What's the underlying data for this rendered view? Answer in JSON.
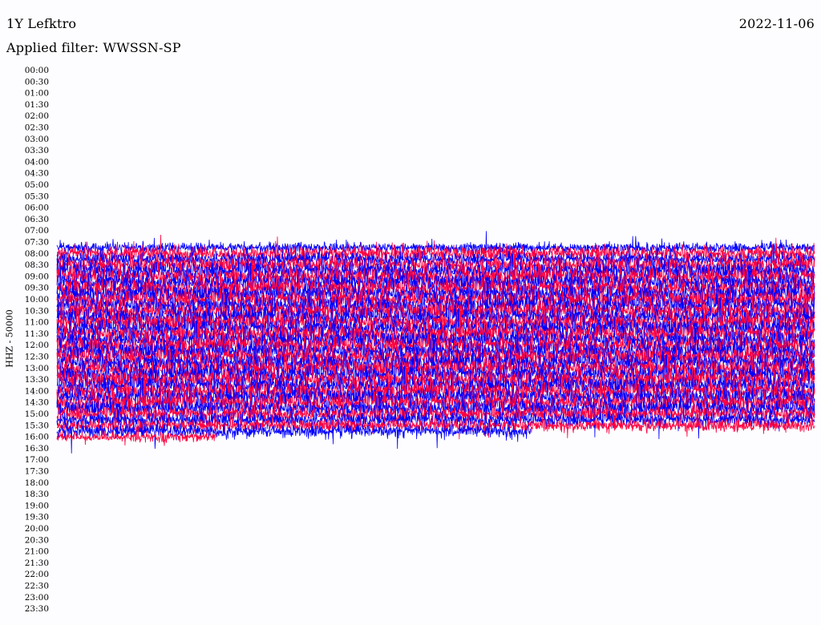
{
  "header": {
    "station": "1Y Lefktro",
    "date": "2022-11-06",
    "filter_text": "Applied filter: WWSSN-SP"
  },
  "chart_data": {
    "type": "line",
    "subtype": "helicorder",
    "ylabel": "HHZ - 50000",
    "row_interval_minutes": 15,
    "row_labels": [
      "00:00",
      "00:30",
      "01:00",
      "01:30",
      "02:00",
      "02:30",
      "03:00",
      "03:30",
      "04:00",
      "04:30",
      "05:00",
      "05:30",
      "06:00",
      "06:30",
      "07:00",
      "07:30",
      "08:00",
      "08:30",
      "09:00",
      "09:30",
      "10:00",
      "10:30",
      "11:00",
      "11:30",
      "12:00",
      "12:30",
      "13:00",
      "13:30",
      "14:00",
      "14:30",
      "15:00",
      "15:30",
      "16:00",
      "16:30",
      "17:00",
      "17:30",
      "18:00",
      "18:30",
      "19:00",
      "19:30",
      "20:00",
      "20:30",
      "21:00",
      "21:30",
      "22:00",
      "22:30",
      "23:00",
      "23:30"
    ],
    "series_colors": [
      "#0000ff",
      "#ff0040"
    ],
    "data_start": "07:45",
    "data_end": "16:30",
    "traces": [
      {
        "start": "07:45",
        "color": "#0000ff",
        "duration_fraction": 1.0,
        "amplitude": 8
      },
      {
        "start": "08:00",
        "color": "#ff0040",
        "duration_fraction": 1.0,
        "amplitude": 12
      },
      {
        "start": "08:15",
        "color": "#0000ff",
        "duration_fraction": 1.0,
        "amplitude": 10
      },
      {
        "start": "08:30",
        "color": "#ff0040",
        "duration_fraction": 1.0,
        "amplitude": 13
      },
      {
        "start": "08:45",
        "color": "#0000ff",
        "duration_fraction": 1.0,
        "amplitude": 14
      },
      {
        "start": "09:00",
        "color": "#ff0040",
        "duration_fraction": 1.0,
        "amplitude": 14
      },
      {
        "start": "09:15",
        "color": "#0000ff",
        "duration_fraction": 1.0,
        "amplitude": 14
      },
      {
        "start": "09:30",
        "color": "#ff0040",
        "duration_fraction": 1.0,
        "amplitude": 14
      },
      {
        "start": "09:45",
        "color": "#0000ff",
        "duration_fraction": 1.0,
        "amplitude": 14
      },
      {
        "start": "10:00",
        "color": "#ff0040",
        "duration_fraction": 1.0,
        "amplitude": 14
      },
      {
        "start": "10:15",
        "color": "#0000ff",
        "duration_fraction": 1.0,
        "amplitude": 14
      },
      {
        "start": "10:30",
        "color": "#ff0040",
        "duration_fraction": 1.0,
        "amplitude": 14
      },
      {
        "start": "10:45",
        "color": "#0000ff",
        "duration_fraction": 1.0,
        "amplitude": 14
      },
      {
        "start": "11:00",
        "color": "#ff0040",
        "duration_fraction": 1.0,
        "amplitude": 14
      },
      {
        "start": "11:15",
        "color": "#0000ff",
        "duration_fraction": 1.0,
        "amplitude": 14
      },
      {
        "start": "11:30",
        "color": "#ff0040",
        "duration_fraction": 1.0,
        "amplitude": 14
      },
      {
        "start": "11:45",
        "color": "#0000ff",
        "duration_fraction": 1.0,
        "amplitude": 14
      },
      {
        "start": "12:00",
        "color": "#ff0040",
        "duration_fraction": 1.0,
        "amplitude": 14
      },
      {
        "start": "12:15",
        "color": "#0000ff",
        "duration_fraction": 1.0,
        "amplitude": 14
      },
      {
        "start": "12:30",
        "color": "#ff0040",
        "duration_fraction": 1.0,
        "amplitude": 14
      },
      {
        "start": "12:45",
        "color": "#0000ff",
        "duration_fraction": 1.0,
        "amplitude": 14
      },
      {
        "start": "13:00",
        "color": "#ff0040",
        "duration_fraction": 1.0,
        "amplitude": 14
      },
      {
        "start": "13:15",
        "color": "#0000ff",
        "duration_fraction": 1.0,
        "amplitude": 14
      },
      {
        "start": "13:30",
        "color": "#ff0040",
        "duration_fraction": 1.0,
        "amplitude": 14
      },
      {
        "start": "13:45",
        "color": "#0000ff",
        "duration_fraction": 1.0,
        "amplitude": 14
      },
      {
        "start": "14:00",
        "color": "#ff0040",
        "duration_fraction": 1.0,
        "amplitude": 14
      },
      {
        "start": "14:15",
        "color": "#0000ff",
        "duration_fraction": 1.0,
        "amplitude": 14
      },
      {
        "start": "14:30",
        "color": "#ff0040",
        "duration_fraction": 1.0,
        "amplitude": 14
      },
      {
        "start": "14:45",
        "color": "#0000ff",
        "duration_fraction": 1.0,
        "amplitude": 13
      },
      {
        "start": "15:00",
        "color": "#ff0040",
        "duration_fraction": 1.0,
        "amplitude": 12
      },
      {
        "start": "15:15",
        "color": "#0000ff",
        "duration_fraction": 1.0,
        "amplitude": 11
      },
      {
        "start": "15:30",
        "color": "#ff0040",
        "duration_fraction": 1.0,
        "amplitude": 10
      },
      {
        "start": "15:45",
        "color": "#0000ff",
        "duration_fraction": 0.625,
        "amplitude": 10
      },
      {
        "start": "16:00",
        "color": "#ff0040",
        "duration_fraction": 0.21,
        "amplitude": 8
      }
    ]
  }
}
